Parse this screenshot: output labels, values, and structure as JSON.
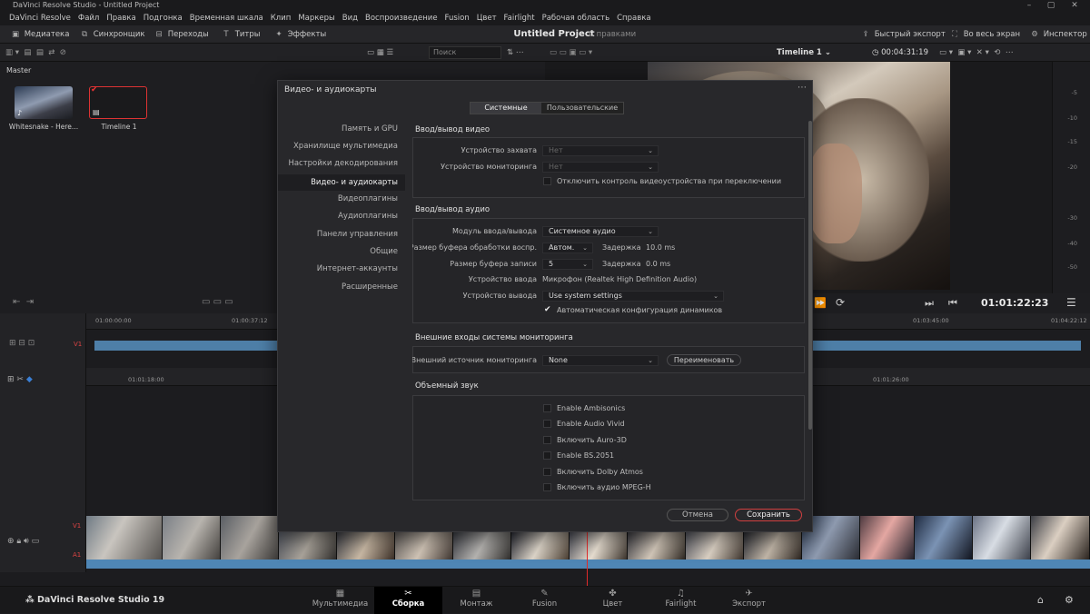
{
  "window": {
    "title": "DaVinci Resolve Studio - Untitled Project"
  },
  "menu": [
    "DaVinci Resolve",
    "Файл",
    "Правка",
    "Подгонка",
    "Временная шкала",
    "Клип",
    "Маркеры",
    "Вид",
    "Воспроизведение",
    "Fusion",
    "Цвет",
    "Fairlight",
    "Рабочая область",
    "Справка"
  ],
  "toolbar": {
    "media_pool": "Медиатека",
    "sync": "Синхронщик",
    "transitions": "Переходы",
    "titles": "Титры",
    "effects": "Эффекты",
    "project_title": "Untitled Project",
    "edited": "С правками",
    "quick_export": "Быстрый экспорт",
    "fullscreen": "Во весь экран",
    "inspector": "Инспектор"
  },
  "search": {
    "placeholder": "Поиск"
  },
  "viewer": {
    "timeline_name": "Timeline 1",
    "duration": "00:04:31:19",
    "timecode": "01:01:22:23"
  },
  "media_pool": {
    "folder": "Master",
    "clips": [
      {
        "name": "Whitesnake - Here..."
      },
      {
        "name": "Timeline 1"
      }
    ]
  },
  "meter_ticks": [
    "-5",
    "-10",
    "-15",
    "-20",
    "-30",
    "-40",
    "-50"
  ],
  "ruler1": [
    "01:00:00:00",
    "01:00:37:12",
    "01:03:45:00",
    "01:04:22:12"
  ],
  "ruler2": [
    "01:01:18:00",
    "01:01:26:00"
  ],
  "tracks": {
    "v1": "V1",
    "a1": "A1"
  },
  "dialog": {
    "title": "Видео- и аудиокарты",
    "tabs": {
      "system": "Системные",
      "user": "Пользовательские"
    },
    "nav": [
      "Память и GPU",
      "Хранилище мультимедиа",
      "Настройки декодирования",
      "Видео- и аудиокарты",
      "Видеоплагины",
      "Аудиоплагины",
      "Панели управления",
      "Общие",
      "Интернет-аккаунты",
      "Расширенные"
    ],
    "video_io": {
      "header": "Ввод/вывод видео",
      "capture_label": "Устройство захвата",
      "capture_value": "Нет",
      "monitor_label": "Устройство мониторинга",
      "monitor_value": "Нет",
      "disable_control": "Отключить контроль видеоустройства при переключении"
    },
    "audio_io": {
      "header": "Ввод/вывод аудио",
      "module_label": "Модуль ввода/вывода",
      "module_value": "Системное аудио",
      "buffer_label": "Размер буфера обработки воспр.",
      "buffer_value": "Автом.",
      "buffer_delay_label": "Задержка",
      "buffer_delay": "10.0 ms",
      "rec_buffer_label": "Размер буфера записи",
      "rec_buffer_value": "5",
      "rec_delay_label": "Задержка",
      "rec_delay": "0.0 ms",
      "input_label": "Устройство ввода",
      "input_value": "Микрофон (Realtek High Definition Audio)",
      "output_label": "Устройство вывода",
      "output_value": "Use system settings",
      "auto_speaker": "Автоматическая конфигурация динамиков"
    },
    "ext_monitor": {
      "header": "Внешние входы системы мониторинга",
      "source_label": "Внешний источник мониторинга",
      "source_value": "None",
      "rename": "Переименовать"
    },
    "surround": {
      "header": "Объемный звук",
      "options": [
        "Enable Ambisonics",
        "Enable Audio Vivid",
        "Включить Auro-3D",
        "Enable BS.2051",
        "Включить Dolby Atmos",
        "Включить аудио MPEG-H"
      ]
    },
    "cancel": "Отмена",
    "save": "Сохранить"
  },
  "pages": [
    "Мультимедиа",
    "Сборка",
    "Монтаж",
    "Fusion",
    "Цвет",
    "Fairlight",
    "Экспорт"
  ],
  "brand": "DaVinci Resolve Studio 19"
}
